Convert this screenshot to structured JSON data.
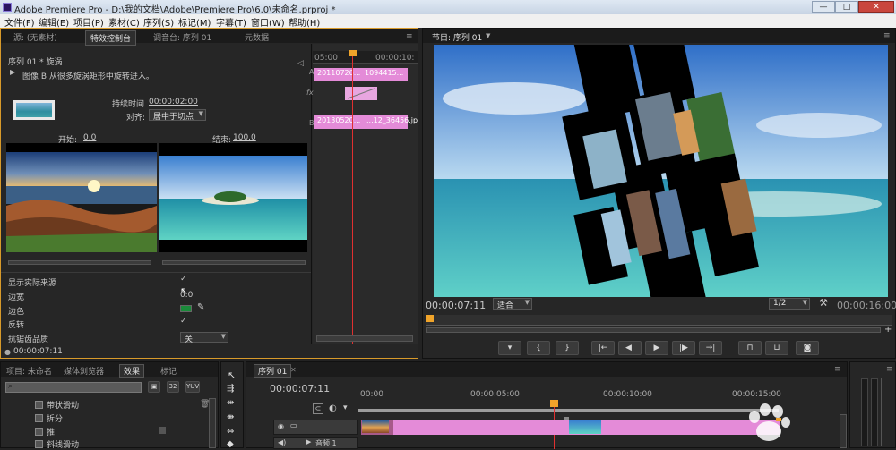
{
  "app": {
    "title": "Adobe Premiere Pro - D:\\我的文档\\Adobe\\Premiere Pro\\6.0\\未命名.prproj *"
  },
  "menu": [
    "文件(F)",
    "编辑(E)",
    "项目(P)",
    "素材(C)",
    "序列(S)",
    "标记(M)",
    "字幕(T)",
    "窗口(W)",
    "帮助(H)"
  ],
  "effect_panel": {
    "tabs": [
      "源: (无素材)",
      "特效控制台",
      "调音台: 序列 01",
      "元数据"
    ],
    "sequence": "序列 01 * 旋涡",
    "description": "图像 B 从很多旋涡矩形中旋转进入。",
    "duration_label": "持续时间",
    "duration_value": "00:00:02:00",
    "align_label": "对齐:",
    "align_value": "居中于切点",
    "start_label": "开始:",
    "start_value": "0.0",
    "end_label": "结束:",
    "end_value": "100.0",
    "ruler_start": "05:00",
    "ruler_end": "00:00:10:",
    "track_a": "A",
    "track_fx": "fx",
    "track_b": "B",
    "clip_a": "20110726...",
    "clip_a2": "1094415...",
    "clip_b": "20130520...",
    "clip_b2": "...12_36456.jp",
    "props": [
      {
        "label": "显示实际来源",
        "value": "✓"
      },
      {
        "label": "边宽",
        "value": "0.0"
      },
      {
        "label": "边色",
        "value": ""
      },
      {
        "label": "反转",
        "value": "✓"
      },
      {
        "label": "抗锯齿品质",
        "value": "关"
      }
    ],
    "timecode": "00:00:07:11"
  },
  "program": {
    "tab": "节目: 序列 01",
    "timecode": "00:00:07:11",
    "fit": "适合",
    "quality": "1/2",
    "duration": "00:00:16:00"
  },
  "project": {
    "tabs": [
      "项目: 未命名",
      "媒体浏览器",
      "效果",
      "标记"
    ],
    "items": [
      "带状滑动",
      "拆分",
      "推",
      "斜线滑动"
    ]
  },
  "timeline": {
    "tab": "序列 01",
    "timecode": "00:00:07:11",
    "ticks": [
      "00:00",
      "00:00:05:00",
      "00:00:10:00",
      "00:00:15:00"
    ],
    "audio_track": "音频 1"
  },
  "colors": {
    "accent": "#f0a42a",
    "clip": "#e48bd8",
    "playhead": "#e03030",
    "edge": "#1a8a3a"
  }
}
